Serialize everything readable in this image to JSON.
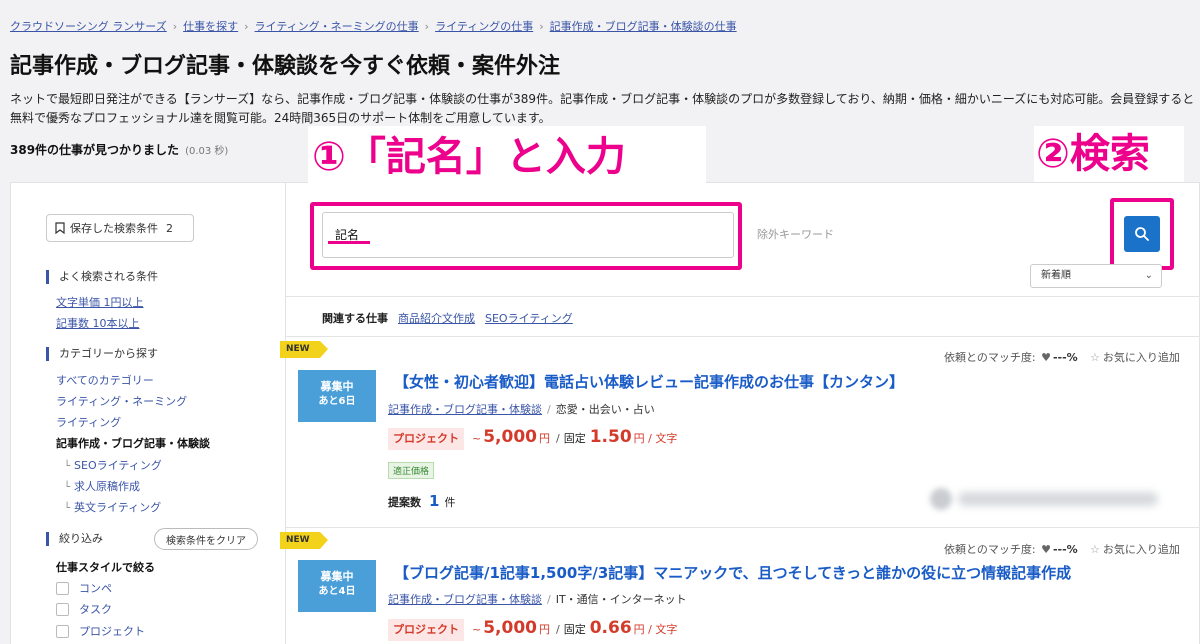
{
  "breadcrumb": [
    "クラウドソーシング ランサーズ",
    "仕事を探す",
    "ライティング・ネーミングの仕事",
    "ライティングの仕事",
    "記事作成・ブログ記事・体験談の仕事"
  ],
  "page_title": "記事作成・ブログ記事・体験談を今すぐ依頼・案件外注",
  "intro": "ネットで最短即日発注ができる【ランサーズ】なら、記事作成・ブログ記事・体験談の仕事が389件。記事作成・ブログ記事・体験談のプロが多数登録しており、納期・価格・細かいニーズにも対応可能。会員登録すると無料で優秀なプロフェッショナル達を閲覧可能。24時間365日のサポート体制をご用意しています。",
  "result_count": {
    "text": "389件の仕事が見つかりました",
    "time": "(0.03 秒)"
  },
  "annotations": {
    "step1": "①「記名」と入力",
    "step2": "②検索",
    "highlight_color": "#ec008c"
  },
  "sidebar": {
    "saved_search_label": "保存した検索条件",
    "saved_search_count": "2",
    "popular_title": "よく検索される条件",
    "popular_items": [
      "文字単価 1円以上",
      "記事数 10本以上"
    ],
    "category_title": "カテゴリーから探す",
    "categories": [
      "すべてのカテゴリー",
      "ライティング・ネーミング",
      "ライティング",
      "記事作成・ブログ記事・体験談"
    ],
    "subcategories": [
      "SEOライティング",
      "求人原稿作成",
      "英文ライティング"
    ],
    "filter_title": "絞り込み",
    "clear_label": "検索条件をクリア",
    "style_title": "仕事スタイルで絞る",
    "styles": [
      "コンペ",
      "タスク",
      "プロジェクト"
    ]
  },
  "search": {
    "keyword_value": "記名",
    "exclude_placeholder": "除外キーワード",
    "search_icon": "search-icon"
  },
  "sort": {
    "selected": "新着順"
  },
  "related": {
    "label": "関連する仕事",
    "tags": [
      "商品紹介文作成",
      "SEOライティング"
    ]
  },
  "jobs": [
    {
      "new_label": "NEW",
      "status": "募集中",
      "remaining": "あと6日",
      "title": "【女性・初心者歓迎】電話占い体験レビュー記事作成のお仕事【カンタン】",
      "category": "記事作成・ブログ記事・体験談",
      "tag": "恋愛・出会い・占い",
      "match_label": "依頼とのマッチ度:",
      "match_value": "---%",
      "fav_label": "お気に入り追加",
      "type": "プロジェクト",
      "price_prefix": "~",
      "price": "5,000",
      "price_unit": "円",
      "fixed_label": "固定",
      "unit_price": "1.50",
      "unit_label": "円 / 文字",
      "fair_label": "適正価格",
      "proposals_label": "提案数",
      "proposals_count": "1",
      "proposals_unit": "件"
    },
    {
      "new_label": "NEW",
      "status": "募集中",
      "remaining": "あと4日",
      "title": "【ブログ記事/1記事1,500字/3記事】マニアックで、且つそしてきっと誰かの役に立つ情報記事作成",
      "category": "記事作成・ブログ記事・体験談",
      "tag": "IT・通信・インターネット",
      "match_label": "依頼とのマッチ度:",
      "match_value": "---%",
      "fav_label": "お気に入り追加",
      "type": "プロジェクト",
      "price_prefix": "~",
      "price": "5,000",
      "price_unit": "円",
      "fixed_label": "固定",
      "unit_price": "0.66",
      "unit_label": "円 / 文字"
    }
  ]
}
